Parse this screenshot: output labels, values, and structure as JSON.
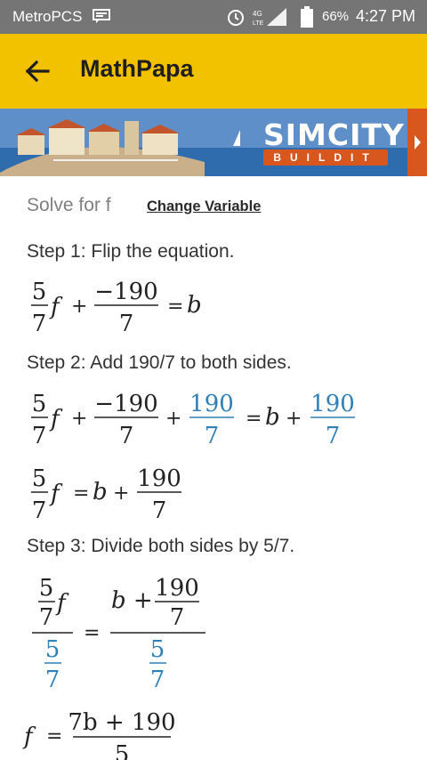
{
  "status": {
    "carrier": "MetroPCS",
    "battery": "66%",
    "time": "4:27 PM",
    "network": "4G LTE"
  },
  "app": {
    "title": "MathPapa"
  },
  "ad": {
    "brand": "SIMCITY",
    "tagline": "BUILDIT"
  },
  "solve": {
    "label": "Solve for f",
    "change_variable": "Change Variable"
  },
  "steps": [
    {
      "label": "Step 1: Flip the equation."
    },
    {
      "label": "Step 2: Add 190/7 to both sides."
    },
    {
      "label": "Step 3: Divide both sides by 5/7."
    }
  ],
  "math": {
    "five": "5",
    "seven": "7",
    "neg190": "−190",
    "n190": "190",
    "f": "f",
    "b": "b",
    "plus": "+",
    "eq": "=",
    "b_plus": "b +",
    "numer_final": "7b + 190"
  },
  "colors": {
    "accent_blue": "#2f7fb8",
    "appbar": "#f2c200",
    "statusbar": "#757575"
  }
}
